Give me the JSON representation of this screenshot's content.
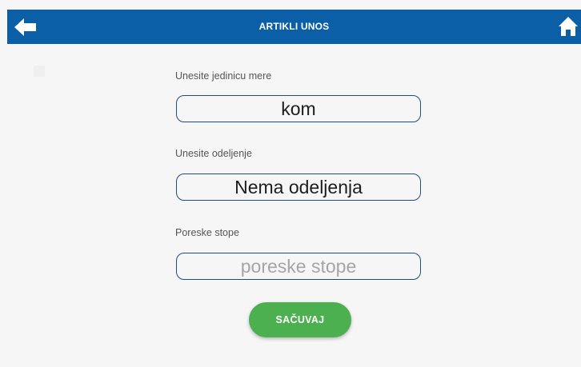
{
  "header": {
    "title": "ARTIKLI UNOS",
    "back_icon": "arrow-left-icon",
    "home_icon": "home-icon",
    "background_color": "#0b5fa7"
  },
  "form": {
    "unit": {
      "label": "Unesite jedinicu mere",
      "value": "kom"
    },
    "department": {
      "label": "Unesite odeljenje",
      "value": "Nema odeljenja"
    },
    "tax_rates": {
      "label": "Poreske stope",
      "value": "",
      "placeholder": "poreske stope"
    },
    "save_label": "SAČUVAJ"
  },
  "colors": {
    "accent_button": "#4caf50",
    "field_border": "#1f4b83"
  }
}
